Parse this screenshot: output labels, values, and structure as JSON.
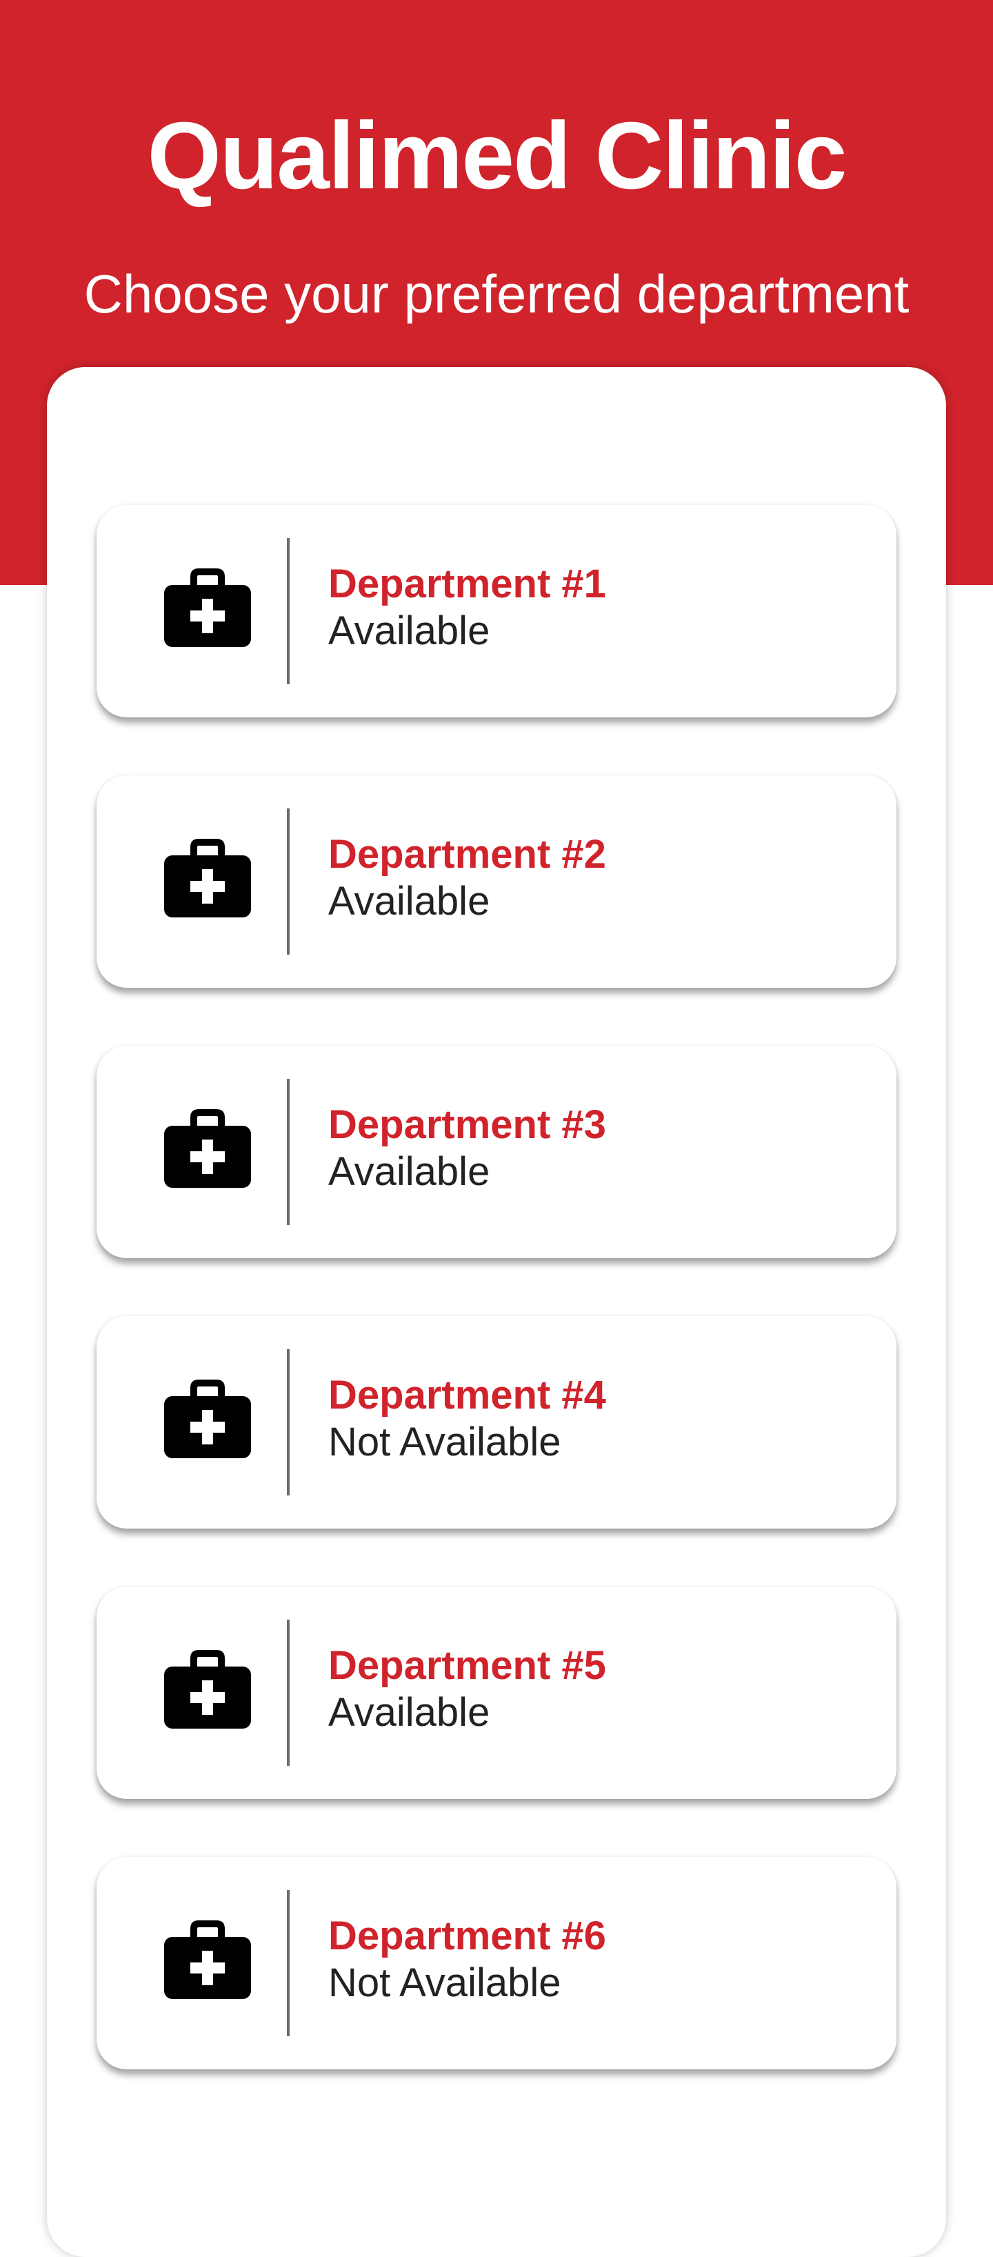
{
  "header": {
    "title": "Qualimed Clinic",
    "subtitle": "Choose your preferred department",
    "background_color": "#d0232b"
  },
  "departments": [
    {
      "name": "Department #1",
      "status": "Available",
      "icon": "medical-bag-icon"
    },
    {
      "name": "Department #2",
      "status": "Available",
      "icon": "medical-bag-icon"
    },
    {
      "name": "Department #3",
      "status": "Available",
      "icon": "medical-bag-icon"
    },
    {
      "name": "Department #4",
      "status": "Not Available",
      "icon": "medical-bag-icon"
    },
    {
      "name": "Department #5",
      "status": "Available",
      "icon": "medical-bag-icon"
    },
    {
      "name": "Department #6",
      "status": "Not Available",
      "icon": "medical-bag-icon"
    }
  ],
  "colors": {
    "accent": "#d0232b",
    "text": "#222222",
    "background": "#ffffff"
  }
}
